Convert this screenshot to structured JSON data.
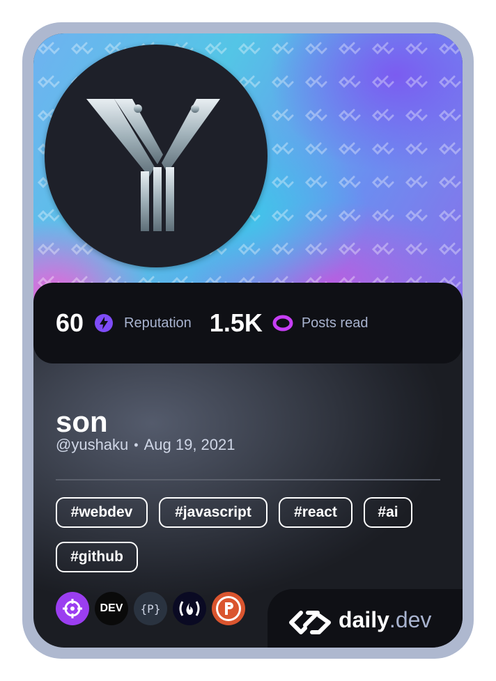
{
  "stats": {
    "reputation_value": "60",
    "reputation_label": "Reputation",
    "posts_value": "1.5K",
    "posts_label": "Posts read"
  },
  "profile": {
    "name": "son",
    "handle": "@yushaku",
    "separator": "•",
    "joined": "Aug 19, 2021"
  },
  "tags": [
    "#webdev",
    "#javascript",
    "#react",
    "#ai",
    "#github"
  ],
  "sources": [
    {
      "name": "crosshair-source-icon",
      "text": "",
      "color": "#9b3ef0"
    },
    {
      "name": "dev-source-icon",
      "text": "DEV",
      "color": "#0a0a0a"
    },
    {
      "name": "p-braces-source-icon",
      "text": "{P}",
      "color": "#2a3340"
    },
    {
      "name": "freecodecamp-source-icon",
      "text": "(🔥)",
      "color": "#0a0a23"
    },
    {
      "name": "producthunt-source-icon",
      "text": "P",
      "color": "#da552f"
    }
  ],
  "brand": {
    "name": "daily",
    "suffix": ".dev"
  },
  "colors": {
    "reputation_accent": "#7f4cf8",
    "posts_accent": "#c73ef5"
  }
}
